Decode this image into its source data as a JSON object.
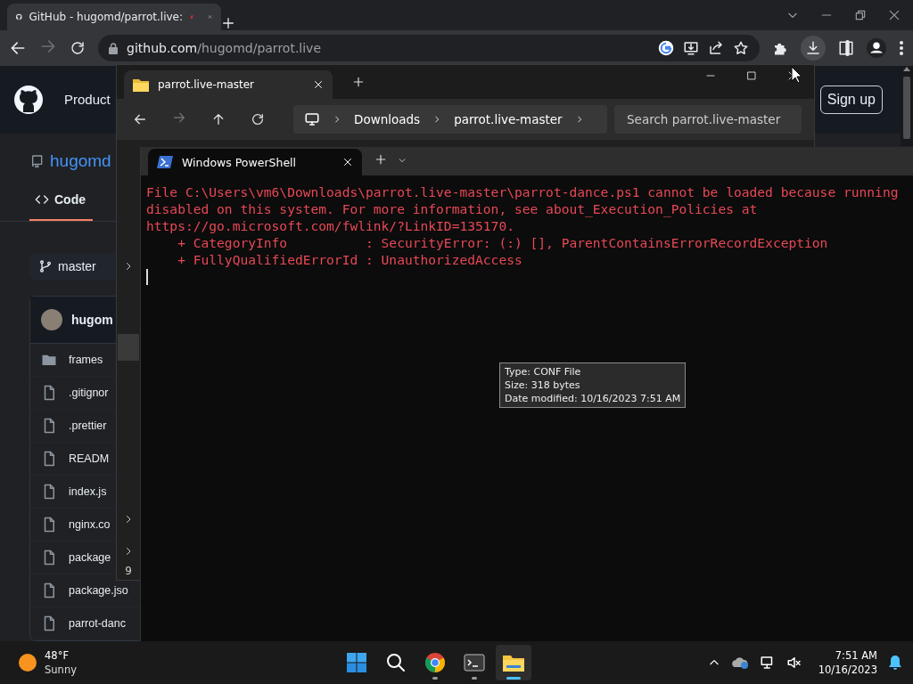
{
  "browser": {
    "tabs": [
      {
        "title": "GitHub - hugomd/parrot.live:",
        "selected": true
      }
    ],
    "nav": {
      "forward_disabled": true
    },
    "address": {
      "host": "github.com",
      "path": "/hugomd/parrot.live"
    }
  },
  "github": {
    "nav_item": "Product",
    "sign_up": "Sign up",
    "repo_owner": "hugomd",
    "tabs": [
      {
        "label": "Code",
        "selected": true
      }
    ],
    "branch": "master",
    "commit_author": "hugom",
    "files": [
      {
        "name": "frames",
        "kind": "folder"
      },
      {
        "name": ".gitignor",
        "kind": "file"
      },
      {
        "name": ".prettier",
        "kind": "file"
      },
      {
        "name": "READM",
        "kind": "file"
      },
      {
        "name": "index.js",
        "kind": "file"
      },
      {
        "name": "nginx.co",
        "kind": "file"
      },
      {
        "name": "package",
        "kind": "file"
      },
      {
        "name": "package.jso",
        "kind": "file"
      },
      {
        "name": "parrot-danc",
        "kind": "file"
      }
    ]
  },
  "explorer": {
    "tab": "parrot.live-master",
    "nav": {
      "forward_disabled": true
    },
    "breadcrumb": [
      "Downloads",
      "parrot.live-master"
    ],
    "search": {
      "placeholder": "Search parrot.live-master"
    },
    "status": "9"
  },
  "terminal": {
    "tab": "Windows PowerShell",
    "lines": [
      "File C:\\Users\\vm6\\Downloads\\parrot.live-master\\parrot-dance.ps1 cannot be loaded because running",
      "disabled on this system. For more information, see about_Execution_Policies at",
      "https://go.microsoft.com/fwlink/?LinkID=135170.",
      "    + CategoryInfo          : SecurityError: (:) [], ParentContainsErrorRecordException",
      "    + FullyQualifiedErrorId : UnauthorizedAccess"
    ]
  },
  "tooltip": {
    "lines": [
      "Type: CONF File",
      "Size: 318 bytes",
      "Date modified: 10/16/2023 7:51 AM"
    ]
  },
  "taskbar": {
    "weather": {
      "temperature": "48°F",
      "condition": "Sunny"
    },
    "apps": [
      {
        "kind": "start",
        "running": false,
        "selected": false
      },
      {
        "kind": "search",
        "running": false,
        "selected": false
      },
      {
        "kind": "chrome",
        "running": true,
        "selected": false
      },
      {
        "kind": "terminal",
        "running": true,
        "selected": false
      },
      {
        "kind": "explorer",
        "running": true,
        "selected": true
      }
    ],
    "time": "7:51 AM",
    "date": "10/16/2023"
  }
}
